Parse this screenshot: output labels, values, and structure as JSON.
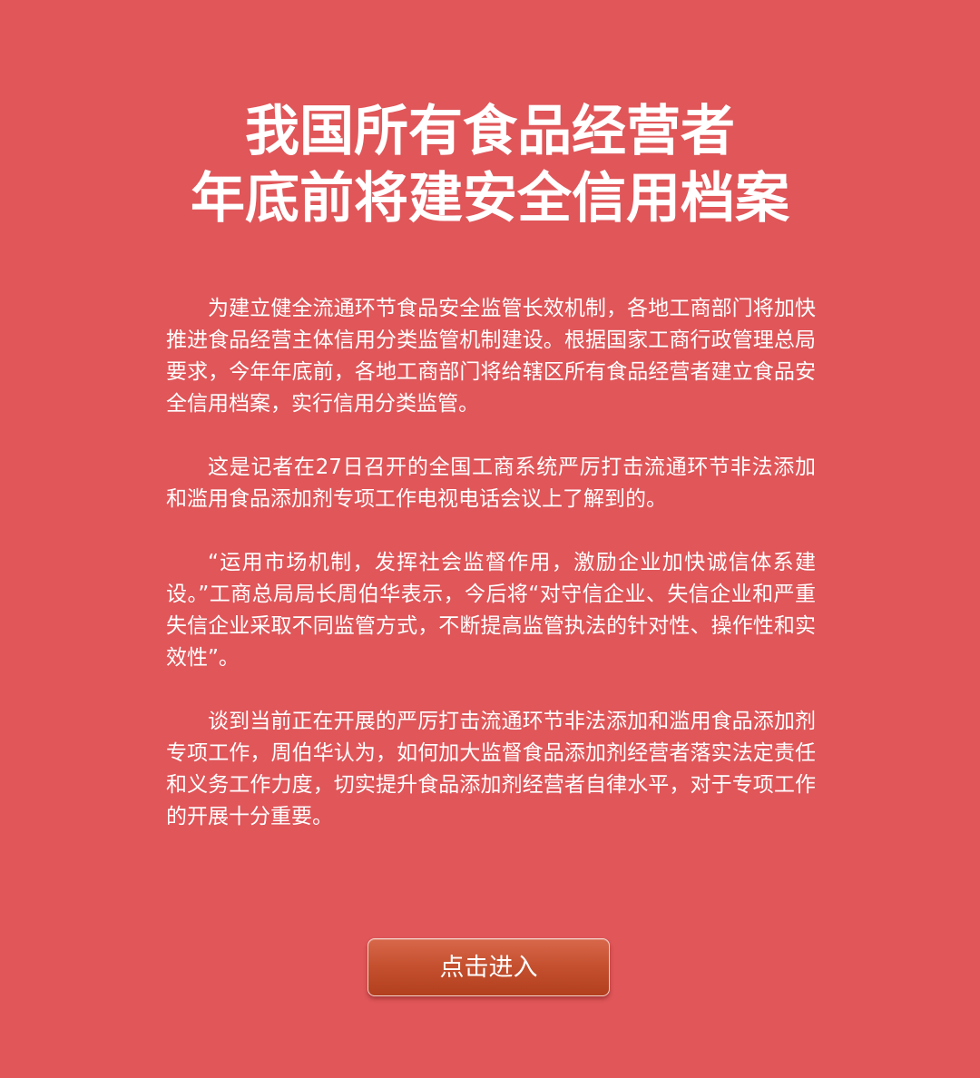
{
  "headline": {
    "line1": "我国所有食品经营者",
    "line2": "年底前将建安全信用档案"
  },
  "article": {
    "paragraphs": [
      "为建立健全流通环节食品安全监管长效机制，各地工商部门将加快推进食品经营主体信用分类监管机制建设。根据国家工商行政管理总局要求，今年年底前，各地工商部门将给辖区所有食品经营者建立食品安全信用档案，实行信用分类监管。",
      "这是记者在27日召开的全国工商系统严厉打击流通环节非法添加和滥用食品添加剂专项工作电视电话会议上了解到的。",
      "“运用市场机制，发挥社会监督作用，激励企业加快诚信体系建设。”工商总局局长周伯华表示，今后将“对守信企业、失信企业和严重失信企业采取不同监管方式，不断提高监管执法的针对性、操作性和实效性”。",
      "谈到当前正在开展的严厉打击流通环节非法添加和滥用食品添加剂专项工作，周伯华认为，如何加大监督食品添加剂经营者落实法定责任和义务工作力度，切实提升食品添加剂经营者自律水平，对于专项工作的开展十分重要。"
    ]
  },
  "enter_button": {
    "label": "点击进入"
  },
  "colors": {
    "background": "#e05659",
    "button": "#c4502f",
    "text": "#ffffff"
  }
}
